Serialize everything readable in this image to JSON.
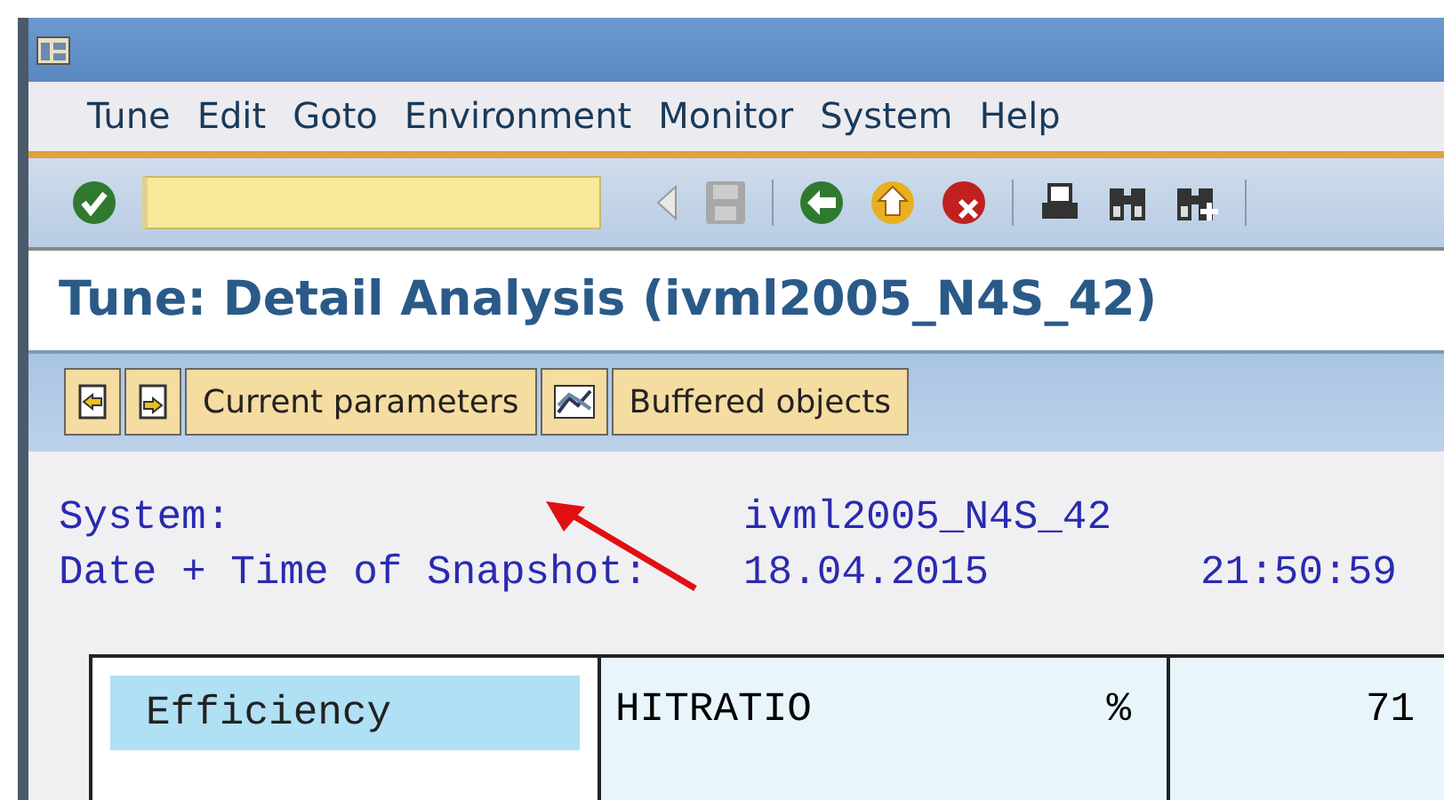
{
  "menu": [
    {
      "label": "Tune"
    },
    {
      "label": "Edit"
    },
    {
      "label": "Goto"
    },
    {
      "label": "Environment"
    },
    {
      "label": "Monitor"
    },
    {
      "label": "System"
    },
    {
      "label": "Help"
    }
  ],
  "toolbar": [
    {
      "kind": "enter",
      "disabled": false
    },
    {
      "kind": "command"
    },
    {
      "kind": "previous",
      "disabled": true
    },
    {
      "kind": "save",
      "disabled": true
    },
    {
      "kind": "sep"
    },
    {
      "kind": "back",
      "disabled": false
    },
    {
      "kind": "exit",
      "disabled": false
    },
    {
      "kind": "cancel",
      "disabled": false
    },
    {
      "kind": "sep"
    },
    {
      "kind": "print",
      "disabled": false
    },
    {
      "kind": "find",
      "disabled": false
    },
    {
      "kind": "find-next",
      "disabled": false
    },
    {
      "kind": "sep"
    }
  ],
  "title": "Tune: Detail Analysis (ivml2005_N4S_42)",
  "app_toolbar": [
    {
      "kind": "prev-page"
    },
    {
      "kind": "next-page"
    },
    {
      "kind": "text",
      "label": "Current parameters"
    },
    {
      "kind": "graph"
    },
    {
      "kind": "text",
      "label": "Buffered objects"
    }
  ],
  "info": [
    {
      "label": "System:",
      "value": "ivml2005_N4S_42"
    },
    {
      "label": "Date + Time of Snapshot:",
      "value": "18.04.2015",
      "time": "21:50:59"
    }
  ],
  "table": {
    "rows": [
      {
        "cells": [
          "Efficiency",
          "HITRATIO",
          "%",
          "71"
        ]
      }
    ]
  }
}
